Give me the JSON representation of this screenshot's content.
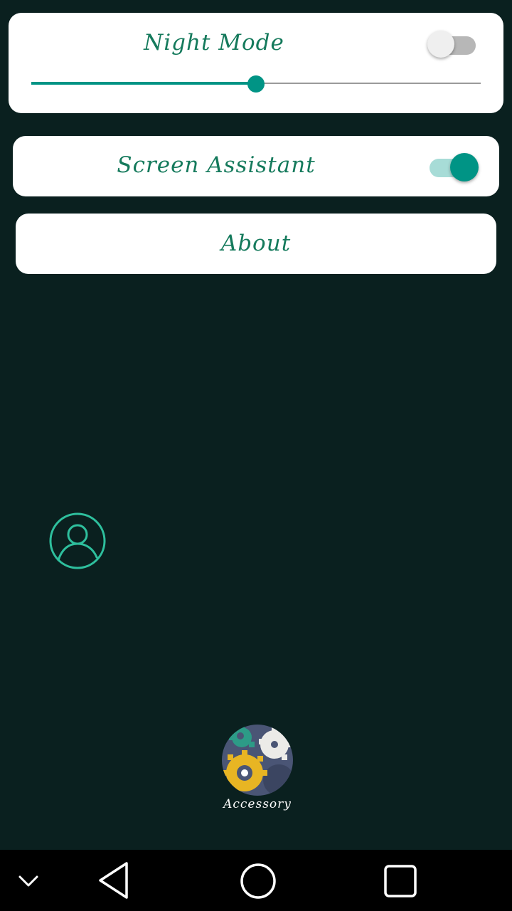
{
  "settings": {
    "night_mode": {
      "label": "Night Mode",
      "enabled": false,
      "brightness_level": 0.5
    },
    "screen_assistant": {
      "label": "Screen Assistant",
      "enabled": true
    },
    "about": {
      "label": "About"
    }
  },
  "profile": {
    "icon": "user-circle-icon"
  },
  "launcher": {
    "accessory_label": "Accessory",
    "icon": "gears-icon"
  },
  "nav_bar": {
    "items": [
      "chevron-down-icon",
      "back-icon",
      "home-icon",
      "recents-icon"
    ]
  },
  "colors": {
    "background": "#0a201f",
    "card": "#ffffff",
    "title_text": "#157a5c",
    "accent": "#009485",
    "accent_light": "#a7dcd7"
  }
}
